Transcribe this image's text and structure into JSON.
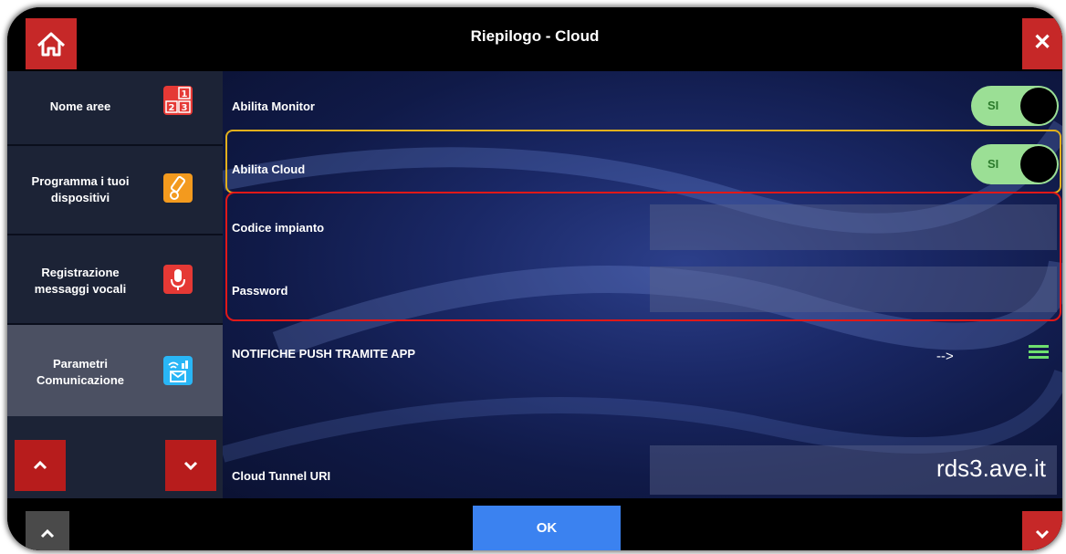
{
  "header": {
    "title": "Riepilogo - Cloud",
    "home_icon": "home-icon",
    "close_icon": "close-icon",
    "close_glyph": "✕"
  },
  "sidebar": {
    "items": [
      {
        "label": "Nome aree",
        "icon": "area-numbers-icon",
        "active": false
      },
      {
        "label": "Programma i tuoi dispositivi",
        "icon": "device-programming-icon",
        "active": false
      },
      {
        "label": "Registrazione messaggi vocali",
        "icon": "microphone-icon",
        "active": false
      },
      {
        "label": "Parametri Comunicazione",
        "icon": "communication-icon",
        "active": true
      }
    ],
    "up_icon": "chevron-up-icon",
    "down_icon": "chevron-down-icon"
  },
  "settings": {
    "abilita_monitor": {
      "label": "Abilita Monitor",
      "toggle": "SI",
      "enabled": true
    },
    "abilita_cloud": {
      "label": "Abilita Cloud",
      "toggle": "SI",
      "enabled": true
    },
    "codice_impianto": {
      "label": "Codice impianto",
      "value": ""
    },
    "password": {
      "label": "Password",
      "value": ""
    },
    "notifiche": {
      "label": "NOTIFICHE PUSH TRAMITE APP",
      "arrow": "-->",
      "menu_icon": "menu-icon"
    },
    "cloud_tunnel": {
      "label": "Cloud Tunnel URI",
      "value": "rds3.ave.it"
    }
  },
  "footer": {
    "ok_label": "OK"
  },
  "colors": {
    "accent_red": "#c62828",
    "ok_blue": "#3b82f0",
    "toggle_green": "#9bdf95",
    "highlight_yellow": "#e2b01c",
    "highlight_red": "#e01818"
  }
}
